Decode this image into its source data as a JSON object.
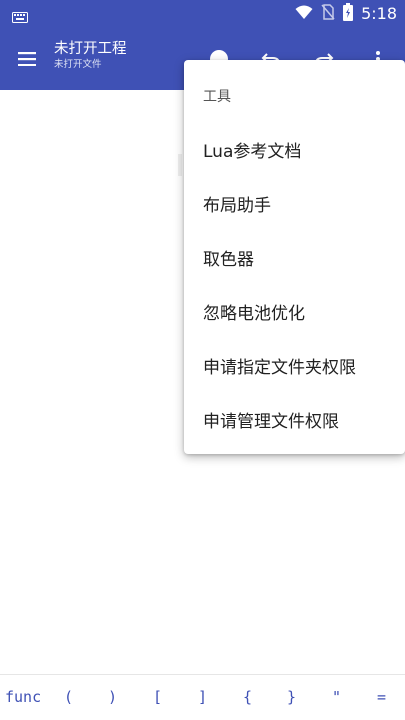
{
  "status_bar": {
    "time": "5:18",
    "icons": [
      "keyboard-icon",
      "wifi-icon",
      "no-sim-icon",
      "battery-icon"
    ]
  },
  "app_bar": {
    "title": "未打开工程",
    "subtitle": "未打开文件",
    "icons": [
      "menu-icon",
      "play-icon",
      "undo-icon",
      "redo-icon",
      "more-vert-icon"
    ]
  },
  "menu": {
    "header": "工具",
    "items": [
      "Lua参考文档",
      "布局助手",
      "取色器",
      "忽略电池优化",
      "申请指定文件夹权限",
      "申请管理文件权限"
    ]
  },
  "symbol_bar": {
    "symbols": [
      "func",
      "(",
      ")",
      "[",
      "]",
      "{",
      "}",
      "\"",
      "="
    ]
  },
  "colors": {
    "primary": "#3f51b5",
    "symbol_text": "#3f51b5",
    "menu_text": "#212121"
  }
}
